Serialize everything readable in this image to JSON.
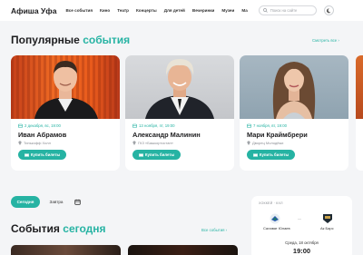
{
  "header": {
    "logo": "Афиша Уфа",
    "nav": [
      "Все события",
      "Кино",
      "Театр",
      "Концерты",
      "Для детей",
      "Вечеринки",
      "Музеи",
      "Ма"
    ],
    "search_placeholder": "Поиск на сайте"
  },
  "popular": {
    "title_main": "Популярные",
    "title_accent": "события",
    "see_all": "Смотреть все",
    "cards": [
      {
        "date": "2 декабря, вс, 19:00",
        "name": "Иван Абрамов",
        "venue": "Тинькофф Холл",
        "buy_label": "Купить билеты"
      },
      {
        "date": "13 ноября, пт, 19:00",
        "name": "Александр Малинин",
        "venue": "ГКЗ «Башкортостан»",
        "buy_label": "Купить билеты"
      },
      {
        "date": "7 ноября, вт, 19:00",
        "name": "Мари Краймбрери",
        "venue": "Дворец Молодёжи",
        "buy_label": "Купить билеты"
      }
    ]
  },
  "filters": {
    "today": "Сегодня",
    "tomorrow": "Завтра"
  },
  "today_events": {
    "title_main": "События",
    "title_accent": "сегодня",
    "see_all": "Все события"
  },
  "match": {
    "league": "ХОККЕЙ · КХЛ",
    "home": "Салават Юлаев",
    "away": "Ак Барс",
    "separator": "—",
    "date": "Среда, 18 октября",
    "time": "19:00"
  },
  "colors": {
    "accent": "#26b3a3",
    "background": "#f4f5f7"
  },
  "icons": [
    "search-icon",
    "moon-icon",
    "calendar-icon",
    "pin-icon",
    "ticket-icon",
    "arrow-right-icon"
  ]
}
